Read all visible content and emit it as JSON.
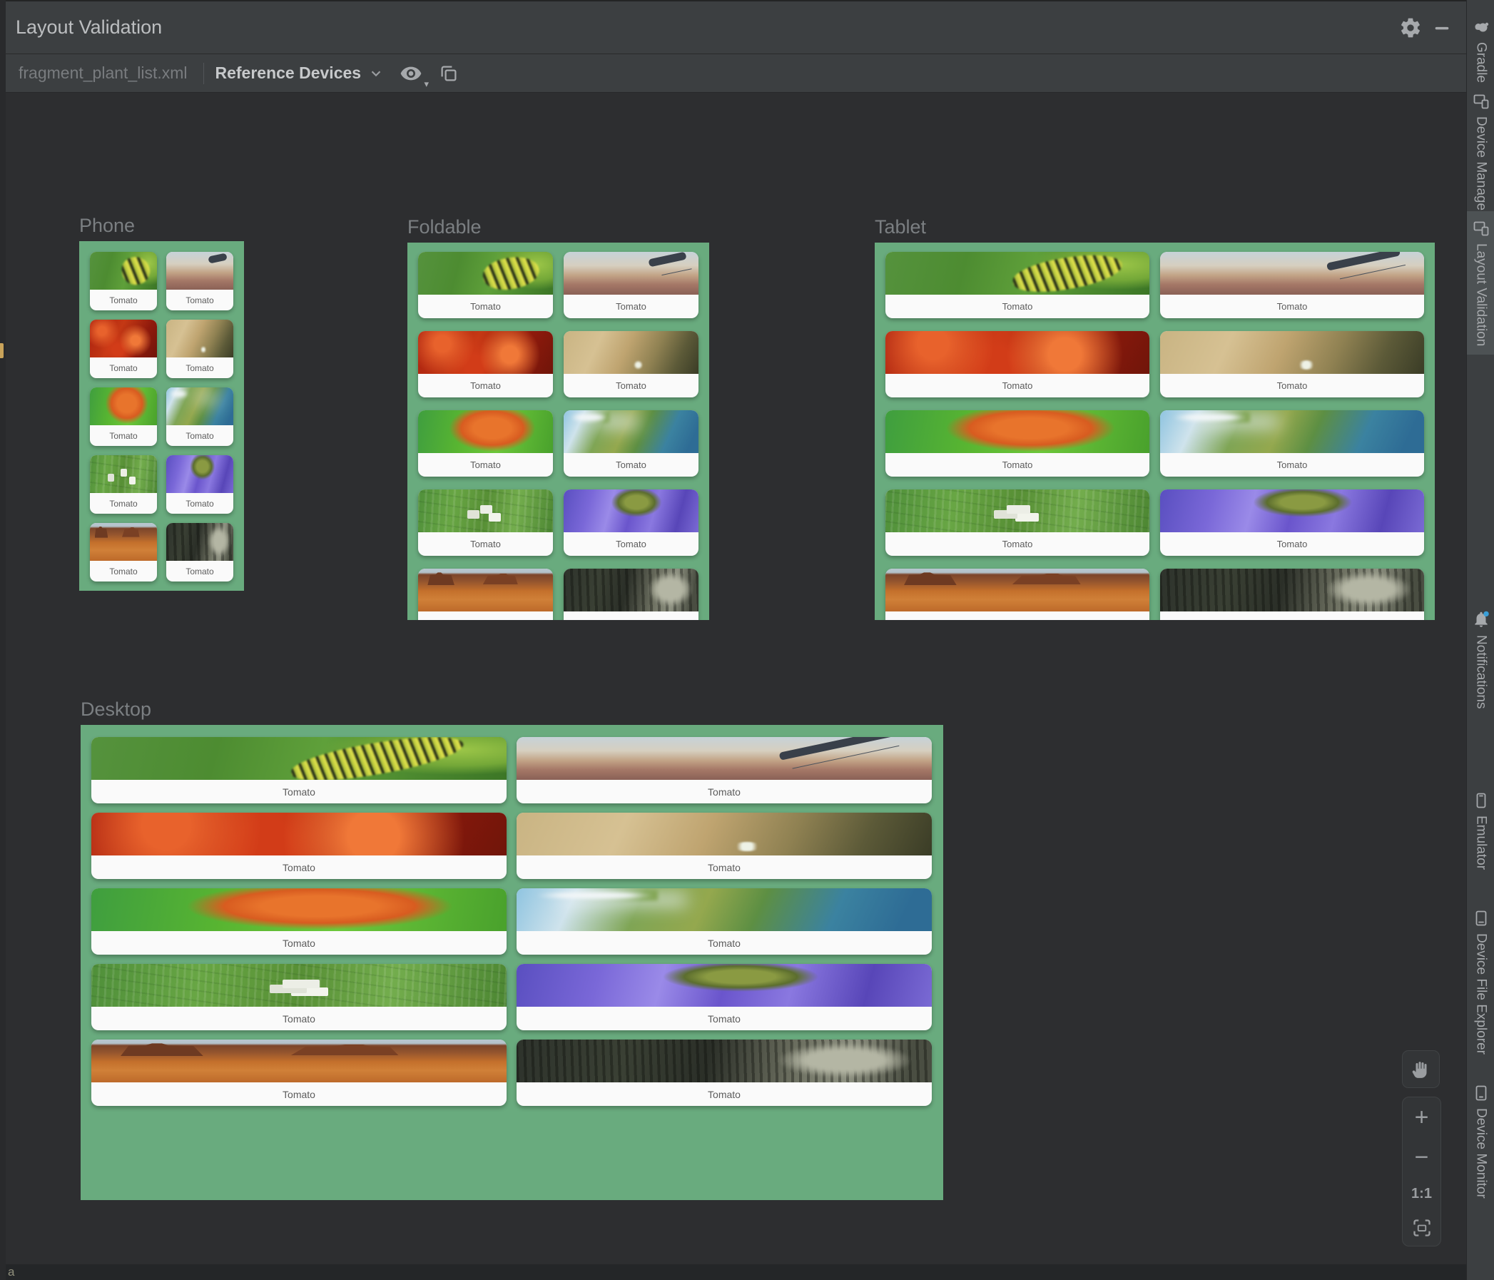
{
  "window": {
    "title": "Layout Validation"
  },
  "toolbar": {
    "file_tab": "fragment_plant_list.xml",
    "device_mode": "Reference Devices"
  },
  "previews": [
    {
      "title": "Phone"
    },
    {
      "title": "Foldable"
    },
    {
      "title": "Tablet"
    },
    {
      "title": "Desktop"
    }
  ],
  "cards": [
    {
      "image": "caterpillar",
      "label": "Tomato"
    },
    {
      "image": "city",
      "label": "Tomato"
    },
    {
      "image": "redmaple",
      "label": "Tomato"
    },
    {
      "image": "wood",
      "label": "Tomato"
    },
    {
      "image": "orangemaple",
      "label": "Tomato"
    },
    {
      "image": "coast",
      "label": "Tomato"
    },
    {
      "image": "farm",
      "label": "Tomato"
    },
    {
      "image": "purple",
      "label": "Tomato"
    },
    {
      "image": "desert",
      "label": "Tomato"
    },
    {
      "image": "forest",
      "label": "Tomato"
    }
  ],
  "sidebar": {
    "items": [
      {
        "label": "Gradle",
        "icon": "gradle-elephant-icon",
        "active": false
      },
      {
        "label": "Device Manager",
        "icon": "device-manager-icon",
        "active": false
      },
      {
        "label": "Layout Validation",
        "icon": "layout-validation-icon",
        "active": true
      },
      {
        "label": "Notifications",
        "icon": "notifications-bell-icon",
        "active": false
      },
      {
        "label": "Emulator",
        "icon": "emulator-icon",
        "active": false
      },
      {
        "label": "Device File Explorer",
        "icon": "device-file-explorer-icon",
        "active": false
      },
      {
        "label": "Device Monitor",
        "icon": "device-monitor-icon",
        "active": false
      }
    ]
  },
  "zoom_controls": {
    "zoom_in": "+",
    "zoom_out": "−",
    "actual_size": "1:1"
  },
  "status_fragment": "a",
  "colors": {
    "device_frame_green": "#69ab7e",
    "panel": "#3c3f41",
    "canvas": "#2d2e30",
    "active_tab": "#4d5254",
    "notification_dot": "#3a9fd8"
  }
}
